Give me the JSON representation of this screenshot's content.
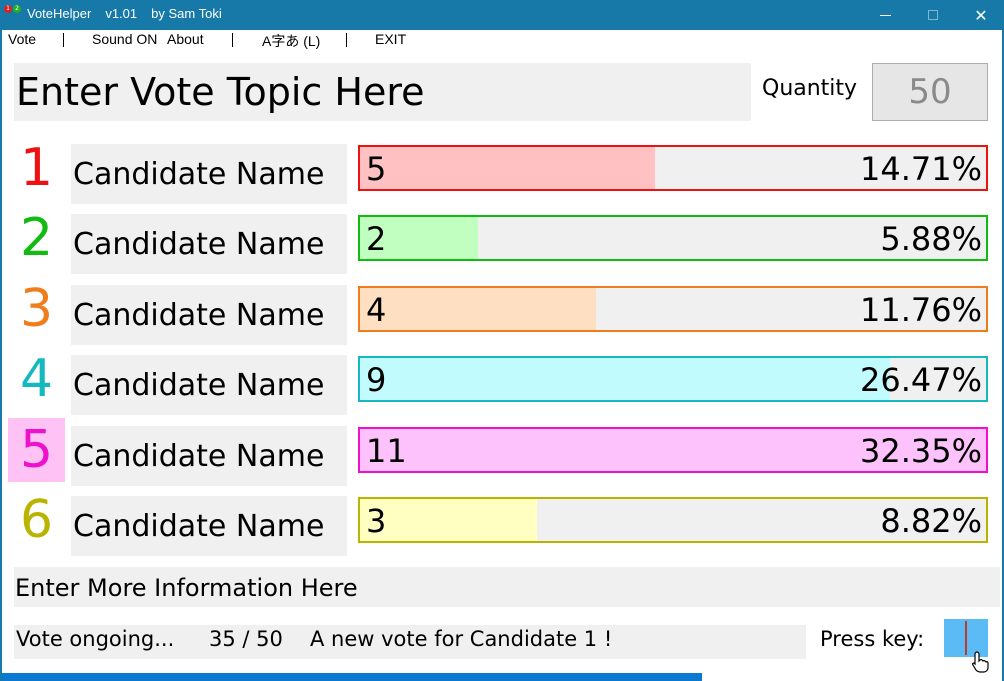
{
  "window": {
    "title_app": "VoteHelper",
    "title_version": "v1.01",
    "title_author": "by Sam Toki"
  },
  "menu": {
    "vote": "Vote",
    "sound": "Sound ON",
    "about": "About",
    "font": "A字あ (L)",
    "exit": "EXIT"
  },
  "topic": "Enter Vote Topic Here",
  "quantity": {
    "label": "Quantity",
    "value": "50"
  },
  "candidates": [
    {
      "number": "1",
      "name": "Candidate Name",
      "votes": "5",
      "percent": "14.71%",
      "share": 0.4706,
      "color": "#ee1111",
      "fill": "#ffc1c1"
    },
    {
      "number": "2",
      "name": "Candidate Name",
      "votes": "2",
      "percent": "5.88%",
      "share": 0.1882,
      "color": "#11bb11",
      "fill": "#c1ffc1"
    },
    {
      "number": "3",
      "name": "Candidate Name",
      "votes": "4",
      "percent": "11.76%",
      "share": 0.3765,
      "color": "#f07d1c",
      "fill": "#ffdfc1"
    },
    {
      "number": "4",
      "name": "Candidate Name",
      "votes": "9",
      "percent": "26.47%",
      "share": 0.8471,
      "color": "#15b8bf",
      "fill": "#c1fbfd"
    },
    {
      "number": "5",
      "name": "Candidate Name",
      "votes": "11",
      "percent": "32.35%",
      "share": 1.0,
      "color": "#ee11cc",
      "fill": "#fdc1fb",
      "highlighted": true
    },
    {
      "number": "6",
      "name": "Candidate Name",
      "votes": "3",
      "percent": "8.82%",
      "share": 0.2824,
      "color": "#b8b400",
      "fill": "#ffffc1"
    }
  ],
  "info": "Enter More Information Here",
  "status": {
    "state": "Vote ongoing...",
    "count": "35 / 50",
    "message": "A new vote for Candidate 1 !",
    "press_label": "Press key:"
  },
  "progress": 0.7,
  "colors": {
    "titlebar": "#1679a7",
    "progress": "#0a7ad1",
    "key_box": "#5bbcf5"
  }
}
